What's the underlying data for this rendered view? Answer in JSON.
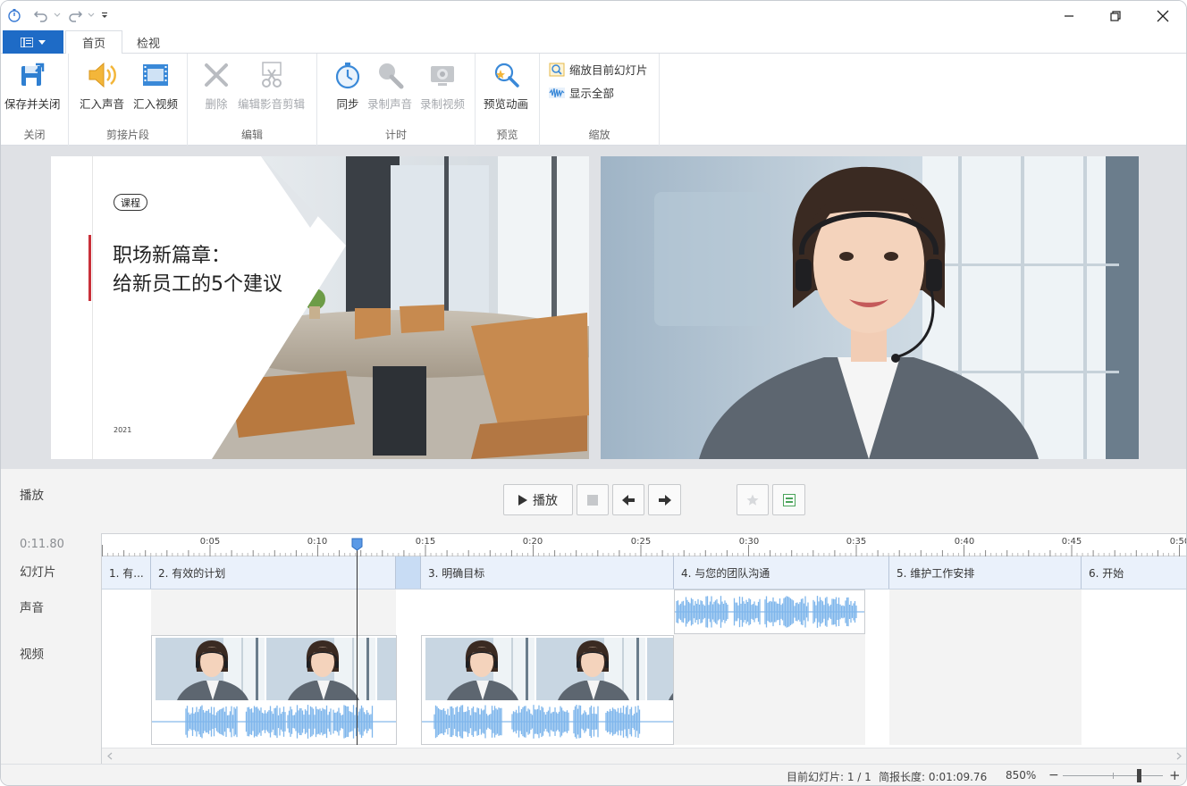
{
  "tabs": {
    "home": "首页",
    "review": "检视"
  },
  "ribbon": {
    "close_group": {
      "label": "关闭",
      "save_close": "保存并关闭"
    },
    "clip_group": {
      "label": "剪接片段",
      "import_audio": "汇入声音",
      "import_video": "汇入视频"
    },
    "edit_group": {
      "label": "编辑",
      "delete": "删除",
      "edit_media": "编辑影音剪辑"
    },
    "timing_group": {
      "label": "计时",
      "sync": "同步",
      "record_audio": "录制声音",
      "record_video": "录制视频"
    },
    "preview_group": {
      "label": "预览",
      "preview_anim": "预览动画"
    },
    "zoom_group": {
      "label": "缩放",
      "zoom_current": "缩放目前幻灯片",
      "show_all": "显示全部"
    }
  },
  "slide": {
    "badge": "课程",
    "title_line1": "职场新篇章：",
    "title_line2": "给新员工的5个建议",
    "year": "2021"
  },
  "playback": {
    "label": "播放",
    "play": "播放"
  },
  "timeline": {
    "current_time": "0:11.80",
    "row_slides": "幻灯片",
    "row_audio": "声音",
    "row_video": "视频",
    "ticks": [
      "0:05",
      "0:10",
      "0:15",
      "0:20",
      "0:25",
      "0:30",
      "0:35",
      "0:40",
      "0:45",
      "0:50"
    ],
    "segments": [
      "1. 有...",
      "2. 有效的计划",
      "3. 明确目标",
      "4. 与您的团队沟通",
      "5. 维护工作安排",
      "6. 开始"
    ]
  },
  "status": {
    "current_slide": "目前幻灯片: 1 / 1",
    "length": "简报长度: 0:01:09.76",
    "zoom": "850%"
  },
  "colors": {
    "accent": "#1e6bc6",
    "wave": "#7fb6ec",
    "slide_red": "#c9303a"
  }
}
